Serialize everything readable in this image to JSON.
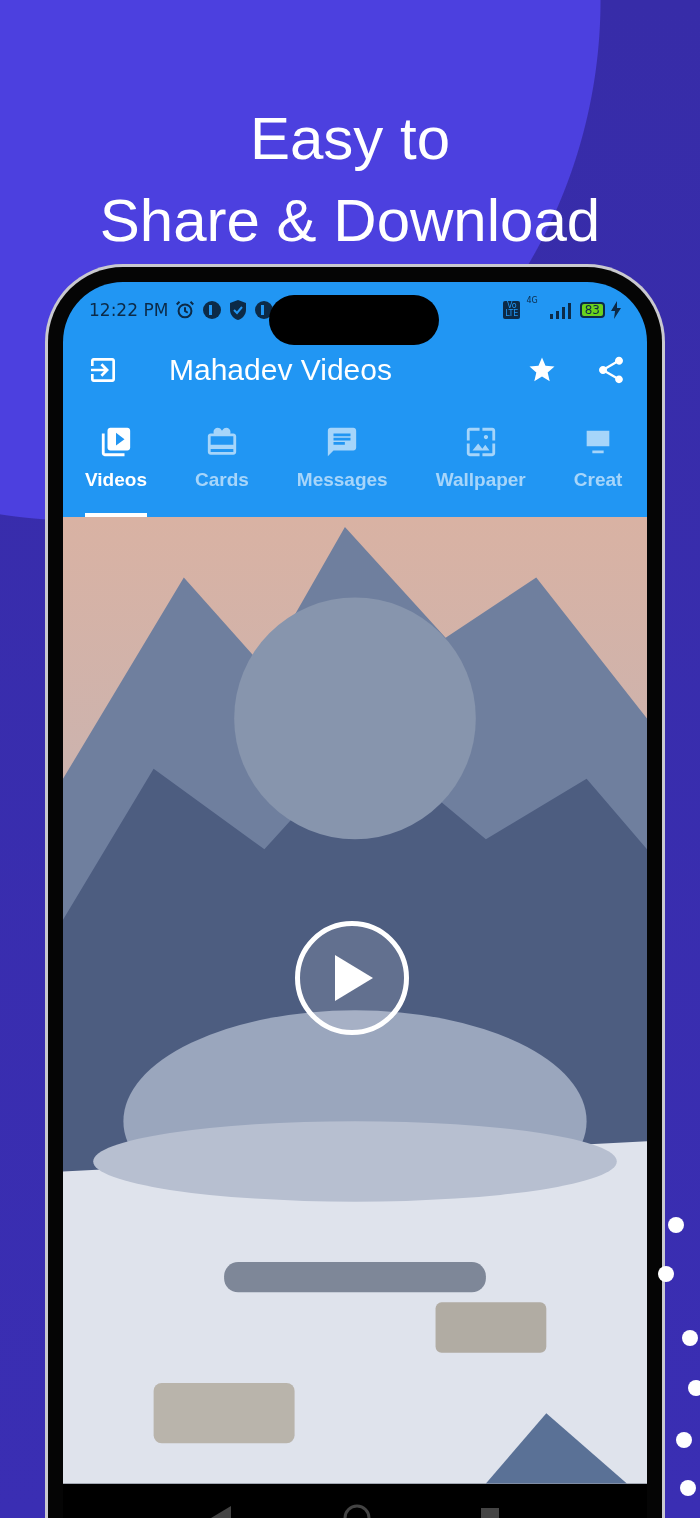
{
  "headline": [
    "Easy to",
    "Share & Download"
  ],
  "status_bar": {
    "time": "12:22 PM",
    "network_badge": [
      "Vo",
      "LTE"
    ],
    "network_type": "4G",
    "battery": "83",
    "charging": true
  },
  "app_bar": {
    "title": "Mahadev Videos"
  },
  "tabs": [
    {
      "label": "Videos",
      "kind": "video",
      "selected": true
    },
    {
      "label": "Cards",
      "kind": "gift",
      "selected": false
    },
    {
      "label": "Messages",
      "kind": "message",
      "selected": false
    },
    {
      "label": "Wallpaper",
      "kind": "wallpaper",
      "selected": false
    },
    {
      "label": "Creat",
      "kind": "create",
      "selected": false
    }
  ]
}
